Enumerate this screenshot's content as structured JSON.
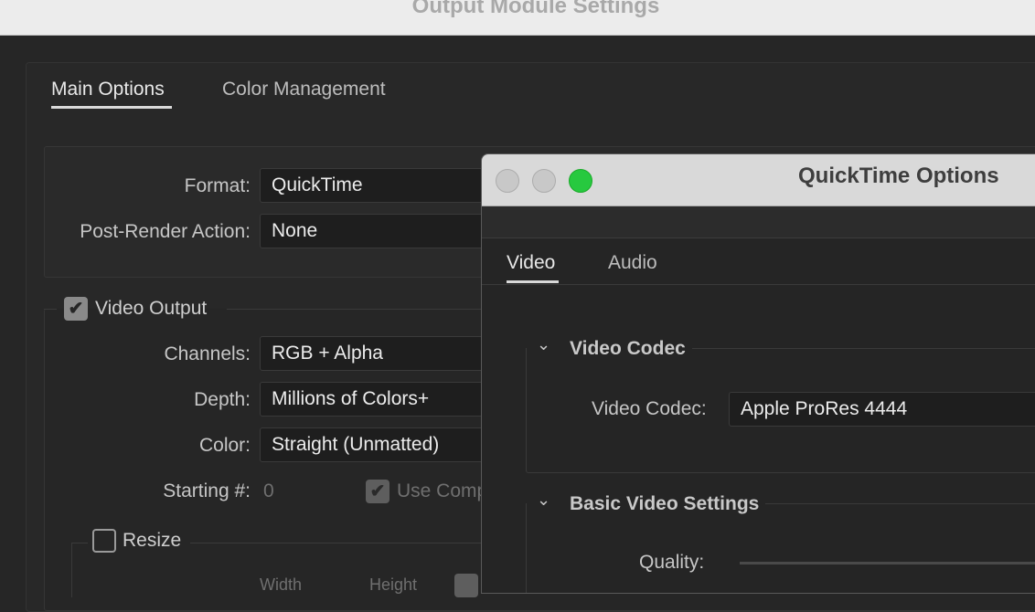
{
  "outer": {
    "title": "Output Module Settings",
    "tabs": [
      {
        "label": "Main Options",
        "active": true
      },
      {
        "label": "Color Management",
        "active": false
      }
    ],
    "format": {
      "label": "Format:",
      "value": "QuickTime"
    },
    "post_render": {
      "label": "Post-Render Action:",
      "value": "None"
    },
    "video_output": {
      "label": "Video Output",
      "checked": true,
      "channels": {
        "label": "Channels:",
        "value": "RGB + Alpha"
      },
      "depth": {
        "label": "Depth:",
        "value": "Millions of Colors+"
      },
      "color": {
        "label": "Color:",
        "value": "Straight (Unmatted)"
      },
      "starting": {
        "label": "Starting #:",
        "value": "0"
      },
      "use_comp": {
        "label": "Use Comp",
        "checked": true,
        "disabled": true
      }
    },
    "resize": {
      "label": "Resize",
      "checked": false,
      "col_width": "Width",
      "col_height": "Height"
    }
  },
  "qt": {
    "title": "QuickTime Options",
    "tabs": [
      {
        "label": "Video",
        "active": true
      },
      {
        "label": "Audio",
        "active": false
      }
    ],
    "video_codec_section": {
      "title": "Video Codec",
      "codec_label": "Video Codec:",
      "codec_value": "Apple ProRes 4444"
    },
    "basic_section": {
      "title": "Basic Video Settings",
      "quality_label": "Quality:"
    }
  },
  "colors": {
    "close": "#c1c1c1",
    "minimize": "#c1c1c1",
    "zoom": "#27c93f"
  },
  "icons": {
    "section_toggle": "chevron-down-icon",
    "check": "checkmark-icon"
  }
}
